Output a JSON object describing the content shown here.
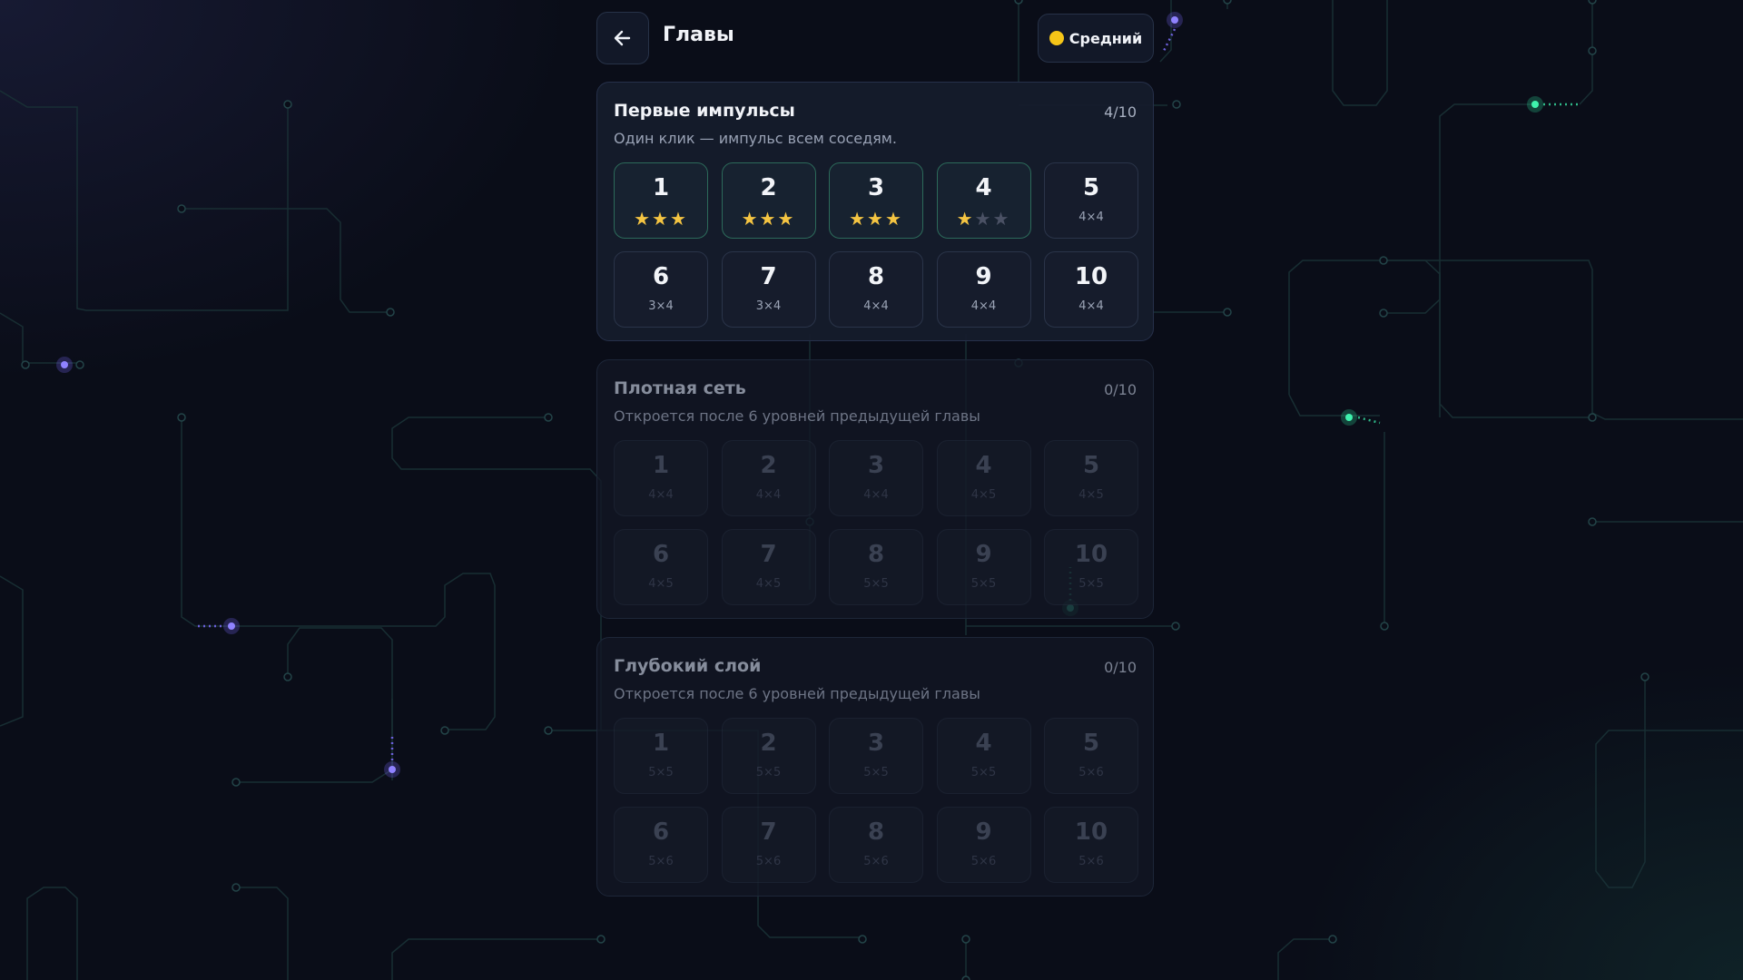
{
  "header": {
    "title": "Главы",
    "back_icon": "arrow-left-icon",
    "difficulty_label": "Средний",
    "difficulty_color": "#f5c518"
  },
  "colors": {
    "background": "#0a0d18",
    "card": "#161c2c",
    "completed_border": "#2c6a5a",
    "star_filled": "#f5c542",
    "star_empty": "#4a5164",
    "circuit_line": "#1c3a3e",
    "glow_purple": "#7b6cff",
    "glow_green": "#2ee8a0"
  },
  "chapters": [
    {
      "title": "Первые импульсы",
      "progress": "4/10",
      "description": "Один клик — импульс всем соседям.",
      "locked": false,
      "levels": [
        {
          "number": "1",
          "size": "",
          "stars": 3,
          "completed": true
        },
        {
          "number": "2",
          "size": "",
          "stars": 3,
          "completed": true
        },
        {
          "number": "3",
          "size": "",
          "stars": 3,
          "completed": true
        },
        {
          "number": "4",
          "size": "",
          "stars": 1,
          "completed": true
        },
        {
          "number": "5",
          "size": "4×4",
          "stars": 0,
          "completed": false
        },
        {
          "number": "6",
          "size": "3×4",
          "stars": 0,
          "completed": false
        },
        {
          "number": "7",
          "size": "3×4",
          "stars": 0,
          "completed": false
        },
        {
          "number": "8",
          "size": "4×4",
          "stars": 0,
          "completed": false
        },
        {
          "number": "9",
          "size": "4×4",
          "stars": 0,
          "completed": false
        },
        {
          "number": "10",
          "size": "4×4",
          "stars": 0,
          "completed": false
        }
      ]
    },
    {
      "title": "Плотная сеть",
      "progress": "0/10",
      "description": "Откроется после 6 уровней предыдущей главы",
      "locked": true,
      "levels": [
        {
          "number": "1",
          "size": "4×4",
          "stars": 0,
          "completed": false
        },
        {
          "number": "2",
          "size": "4×4",
          "stars": 0,
          "completed": false
        },
        {
          "number": "3",
          "size": "4×4",
          "stars": 0,
          "completed": false
        },
        {
          "number": "4",
          "size": "4×5",
          "stars": 0,
          "completed": false
        },
        {
          "number": "5",
          "size": "4×5",
          "stars": 0,
          "completed": false
        },
        {
          "number": "6",
          "size": "4×5",
          "stars": 0,
          "completed": false
        },
        {
          "number": "7",
          "size": "4×5",
          "stars": 0,
          "completed": false
        },
        {
          "number": "8",
          "size": "5×5",
          "stars": 0,
          "completed": false
        },
        {
          "number": "9",
          "size": "5×5",
          "stars": 0,
          "completed": false
        },
        {
          "number": "10",
          "size": "5×5",
          "stars": 0,
          "completed": false
        }
      ]
    },
    {
      "title": "Глубокий слой",
      "progress": "0/10",
      "description": "Откроется после 6 уровней предыдущей главы",
      "locked": true,
      "levels": [
        {
          "number": "1",
          "size": "5×5",
          "stars": 0,
          "completed": false
        },
        {
          "number": "2",
          "size": "5×5",
          "stars": 0,
          "completed": false
        },
        {
          "number": "3",
          "size": "5×5",
          "stars": 0,
          "completed": false
        },
        {
          "number": "4",
          "size": "5×5",
          "stars": 0,
          "completed": false
        },
        {
          "number": "5",
          "size": "5×6",
          "stars": 0,
          "completed": false
        },
        {
          "number": "6",
          "size": "5×6",
          "stars": 0,
          "completed": false
        },
        {
          "number": "7",
          "size": "5×6",
          "stars": 0,
          "completed": false
        },
        {
          "number": "8",
          "size": "5×6",
          "stars": 0,
          "completed": false
        },
        {
          "number": "9",
          "size": "5×6",
          "stars": 0,
          "completed": false
        },
        {
          "number": "10",
          "size": "5×6",
          "stars": 0,
          "completed": false
        }
      ]
    }
  ]
}
